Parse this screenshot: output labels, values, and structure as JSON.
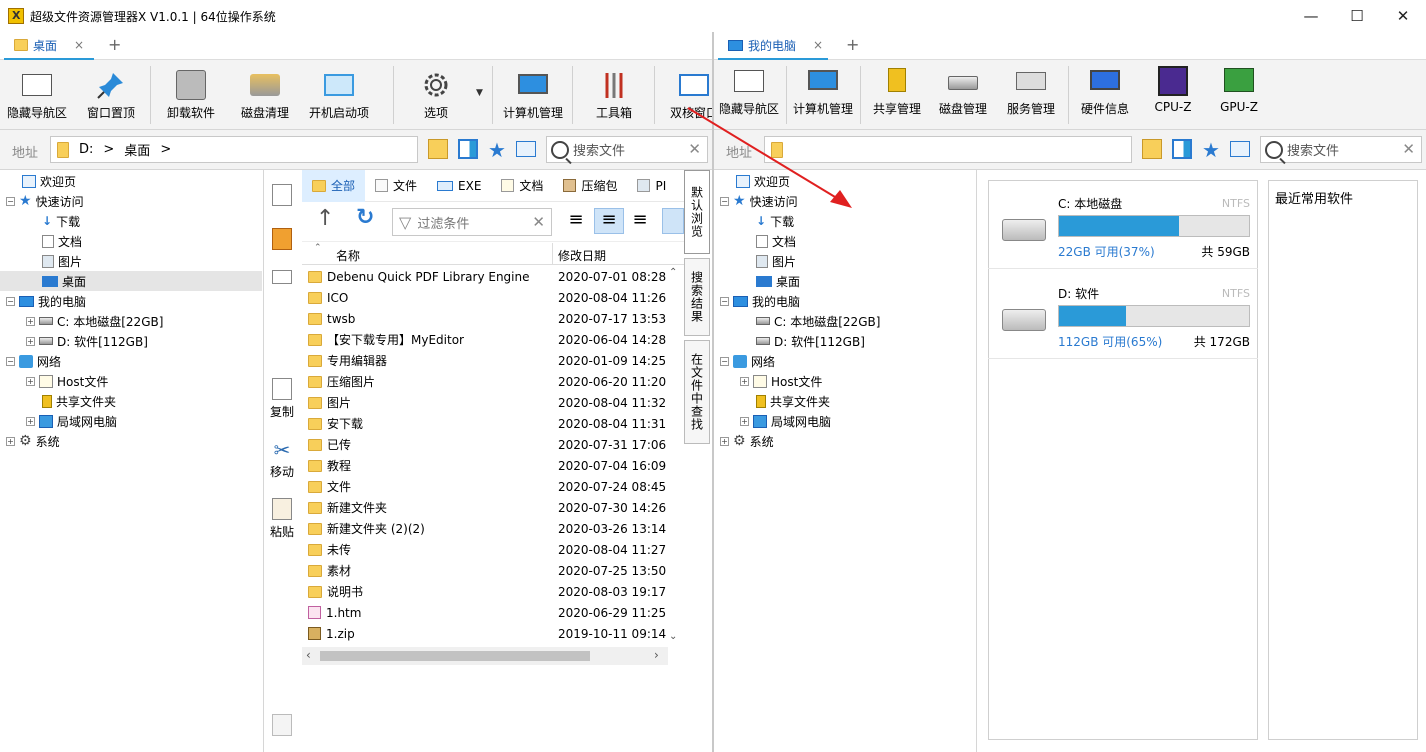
{
  "window": {
    "title": "超级文件资源管理器X V1.0.1  |  64位操作系统",
    "minimize": "—",
    "maximize": "☐",
    "close": "✕"
  },
  "left_tabs": [
    {
      "label": "桌面"
    }
  ],
  "right_tabs": [
    {
      "label": "我的电脑"
    }
  ],
  "tab_plus": "+",
  "tab_close": "×",
  "left_toolbar": [
    "隐藏导航区",
    "窗口置顶",
    "卸载软件",
    "磁盘清理",
    "开机启动项",
    "选项",
    "计算机管理",
    "工具箱",
    "双核窗口"
  ],
  "right_toolbar": [
    "隐藏导航区",
    "计算机管理",
    "共享管理",
    "磁盘管理",
    "服务管理",
    "硬件信息",
    "CPU-Z",
    "GPU-Z"
  ],
  "left_address": {
    "label": "地址",
    "drive": "D:",
    "sep": ">",
    "folder": "桌面",
    "sep2": ">",
    "search_placeholder": "搜索文件"
  },
  "right_address": {
    "label": "地址",
    "search_placeholder": "搜索文件"
  },
  "left_tree": [
    {
      "label": "欢迎页"
    },
    {
      "label": "快速访问"
    },
    {
      "label": "下载"
    },
    {
      "label": "文档"
    },
    {
      "label": "图片"
    },
    {
      "label": "桌面"
    },
    {
      "label": "我的电脑"
    },
    {
      "label": "C: 本地磁盘[22GB]"
    },
    {
      "label": "D: 软件[112GB]"
    },
    {
      "label": "网络"
    },
    {
      "label": "Host文件"
    },
    {
      "label": "共享文件夹"
    },
    {
      "label": "局域网电脑"
    },
    {
      "label": "系统"
    }
  ],
  "right_tree": [
    {
      "label": "欢迎页"
    },
    {
      "label": "快速访问"
    },
    {
      "label": "下载"
    },
    {
      "label": "文档"
    },
    {
      "label": "图片"
    },
    {
      "label": "桌面"
    },
    {
      "label": "我的电脑"
    },
    {
      "label": "C: 本地磁盘[22GB]"
    },
    {
      "label": "D: 软件[112GB]"
    },
    {
      "label": "网络"
    },
    {
      "label": "Host文件"
    },
    {
      "label": "共享文件夹"
    },
    {
      "label": "局域网电脑"
    },
    {
      "label": "系统"
    }
  ],
  "side_actions": {
    "copy": "复制",
    "move": "移动",
    "paste": "粘贴"
  },
  "file_tabs": [
    "全部",
    "文件",
    "EXE",
    "文档",
    "压缩包",
    "PI"
  ],
  "filter_placeholder": "过滤条件",
  "columns": {
    "name": "名称",
    "date": "修改日期"
  },
  "files": [
    {
      "name": "Debenu Quick PDF Library Engine",
      "date": "2020-07-01 08:28",
      "kind": "folder"
    },
    {
      "name": "ICO",
      "date": "2020-08-04 11:26",
      "kind": "folder"
    },
    {
      "name": "twsb",
      "date": "2020-07-17 13:53",
      "kind": "folder"
    },
    {
      "name": "【安下载专用】MyEditor",
      "date": "2020-06-04 14:28",
      "kind": "folder"
    },
    {
      "name": "专用编辑器",
      "date": "2020-01-09 14:25",
      "kind": "folder"
    },
    {
      "name": "压缩图片",
      "date": "2020-06-20 11:20",
      "kind": "folder"
    },
    {
      "name": "图片",
      "date": "2020-08-04 11:32",
      "kind": "folder"
    },
    {
      "name": "安下载",
      "date": "2020-08-04 11:31",
      "kind": "folder"
    },
    {
      "name": "已传",
      "date": "2020-07-31 17:06",
      "kind": "folder"
    },
    {
      "name": "教程",
      "date": "2020-07-04 16:09",
      "kind": "folder"
    },
    {
      "name": "文件",
      "date": "2020-07-24 08:45",
      "kind": "folder"
    },
    {
      "name": "新建文件夹",
      "date": "2020-07-30 14:26",
      "kind": "folder"
    },
    {
      "name": "新建文件夹 (2)(2)",
      "date": "2020-03-26 13:14",
      "kind": "folder"
    },
    {
      "name": "未传",
      "date": "2020-08-04 11:27",
      "kind": "folder"
    },
    {
      "name": "素材",
      "date": "2020-07-25 13:50",
      "kind": "folder"
    },
    {
      "name": "说明书",
      "date": "2020-08-03 19:17",
      "kind": "folder"
    },
    {
      "name": "1.htm",
      "date": "2020-06-29 11:25",
      "kind": "htm"
    },
    {
      "name": "1.zip",
      "date": "2019-10-11 09:14",
      "kind": "zip"
    }
  ],
  "view_tabs": [
    "默认浏览",
    "搜索结果",
    "在文件中查找"
  ],
  "drives": [
    {
      "name": "C: 本地磁盘",
      "fs": "NTFS",
      "used_fraction": 0.63,
      "free": "22GB 可用(37%)",
      "total": "共 59GB"
    },
    {
      "name": "D: 软件",
      "fs": "NTFS",
      "used_fraction": 0.35,
      "free": "112GB 可用(65%)",
      "total": "共 172GB"
    }
  ],
  "recent_software_title": "最近常用软件",
  "colors": {
    "accent": "#2a9ad8",
    "link": "#1a5fb4",
    "arrow": "#e02020"
  }
}
